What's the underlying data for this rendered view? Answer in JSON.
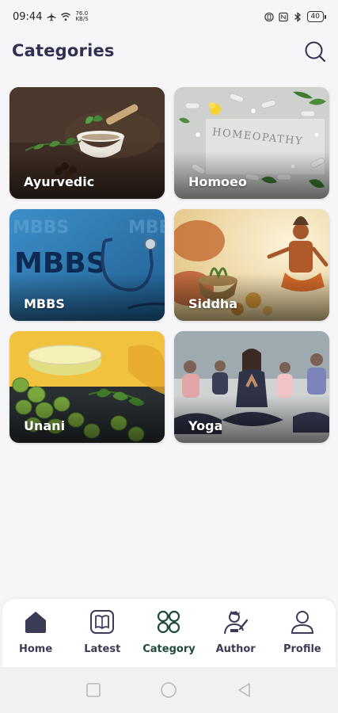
{
  "status_bar": {
    "time": "09:44",
    "speed_value": "76.0",
    "speed_unit": "KB/S",
    "battery": "40"
  },
  "header": {
    "title": "Categories",
    "search_icon": "search-icon"
  },
  "categories": [
    {
      "label": "Ayurvedic"
    },
    {
      "label": "Homoeo",
      "image_text": "HOMEOPATHY"
    },
    {
      "label": "MBBS",
      "image_text": "MBBS"
    },
    {
      "label": "Siddha"
    },
    {
      "label": "Unani"
    },
    {
      "label": "Yoga"
    }
  ],
  "bottom_nav": {
    "items": [
      {
        "label": "Home",
        "icon": "home-icon"
      },
      {
        "label": "Latest",
        "icon": "book-icon"
      },
      {
        "label": "Category",
        "icon": "grid-icon"
      },
      {
        "label": "Author",
        "icon": "author-icon"
      },
      {
        "label": "Profile",
        "icon": "profile-icon"
      }
    ],
    "active": "Category"
  },
  "colors": {
    "title": "#303150",
    "active_nav": "#1f4a3a",
    "background": "#f6f6f8"
  }
}
